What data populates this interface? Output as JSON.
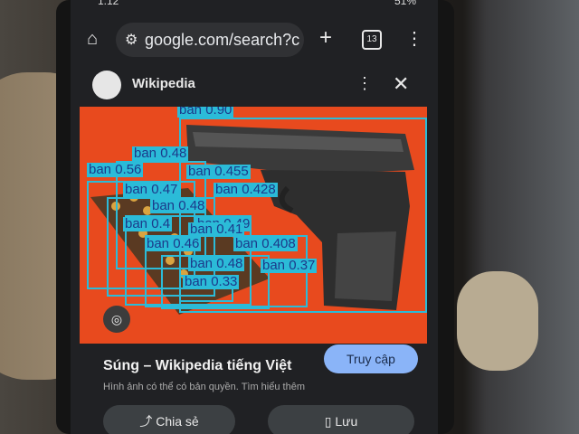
{
  "status": {
    "time": "1:12",
    "battery": "51%"
  },
  "browser": {
    "url": "google.com/search?cl",
    "tab_count": "13"
  },
  "result": {
    "site_name": "Wikipedia",
    "title": "Súng – Wikipedia tiếng Việt",
    "visit_label": "Truy cập",
    "copyright_text": "Hình ảnh có thể có bản quyền. Tìm hiểu thêm",
    "share_label": "Chia sẻ",
    "save_label": "Lưu"
  },
  "detections": [
    {
      "label": "ban 0.90"
    },
    {
      "label": "ban 0.48"
    },
    {
      "label": "ban 0.56"
    },
    {
      "label": "ban 0.455"
    },
    {
      "label": "ban 0.47"
    },
    {
      "label": "ban 0.428"
    },
    {
      "label": "ban 0.48"
    },
    {
      "label": "ban 0.4"
    },
    {
      "label": "ban 0.49"
    },
    {
      "label": "ban 0.46"
    },
    {
      "label": "ban 0.41"
    },
    {
      "label": "ban 0.408"
    },
    {
      "label": "ban 0.48"
    },
    {
      "label": "ban 0.37"
    },
    {
      "label": "ban 0.33"
    }
  ]
}
